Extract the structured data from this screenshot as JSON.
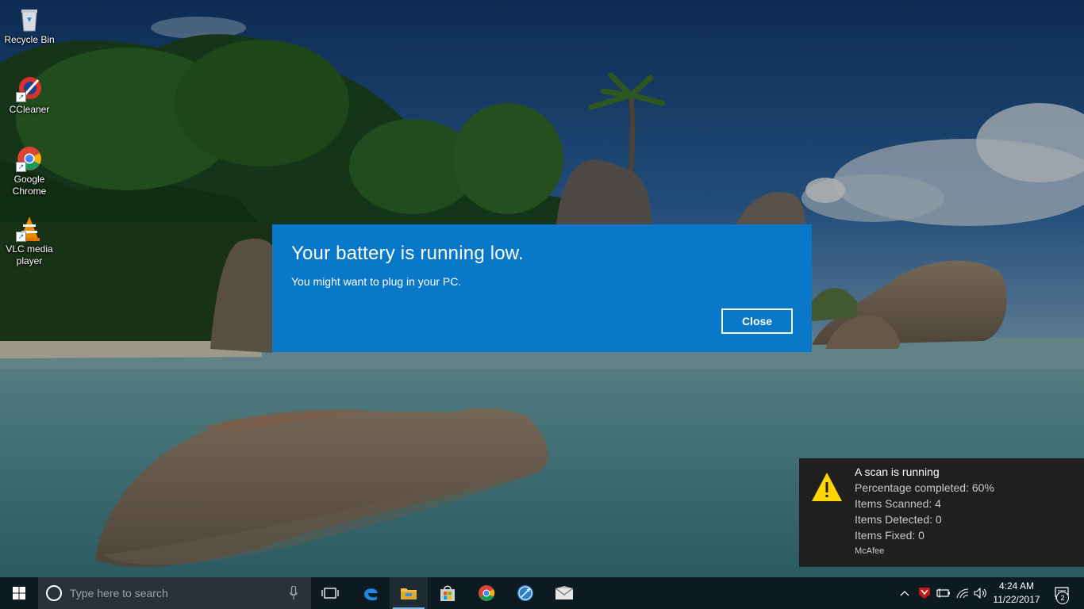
{
  "desktop": {
    "icons": [
      {
        "label": "Recycle Bin"
      },
      {
        "label": "CCleaner"
      },
      {
        "label": "Google Chrome"
      },
      {
        "label": "VLC media player"
      }
    ]
  },
  "battery_dialog": {
    "title": "Your battery is running low.",
    "message": "You might want to plug in your PC.",
    "close_label": "Close",
    "background_color": "#0a78c8"
  },
  "toast": {
    "title": "A scan is running",
    "lines": [
      "Percentage completed: 60%",
      "Items Scanned: 4",
      "Items Detected: 0",
      "Items Fixed: 0"
    ],
    "source": "McAfee",
    "icon": "warning-icon"
  },
  "taskbar": {
    "search_placeholder": "Type here to search",
    "apps": [
      "task-view-icon",
      "edge-icon",
      "file-explorer-icon",
      "store-icon",
      "chrome-icon",
      "app-icon",
      "mail-icon"
    ],
    "clock": {
      "time": "4:24 AM",
      "date": "11/22/2017"
    },
    "notification_count": "2"
  }
}
